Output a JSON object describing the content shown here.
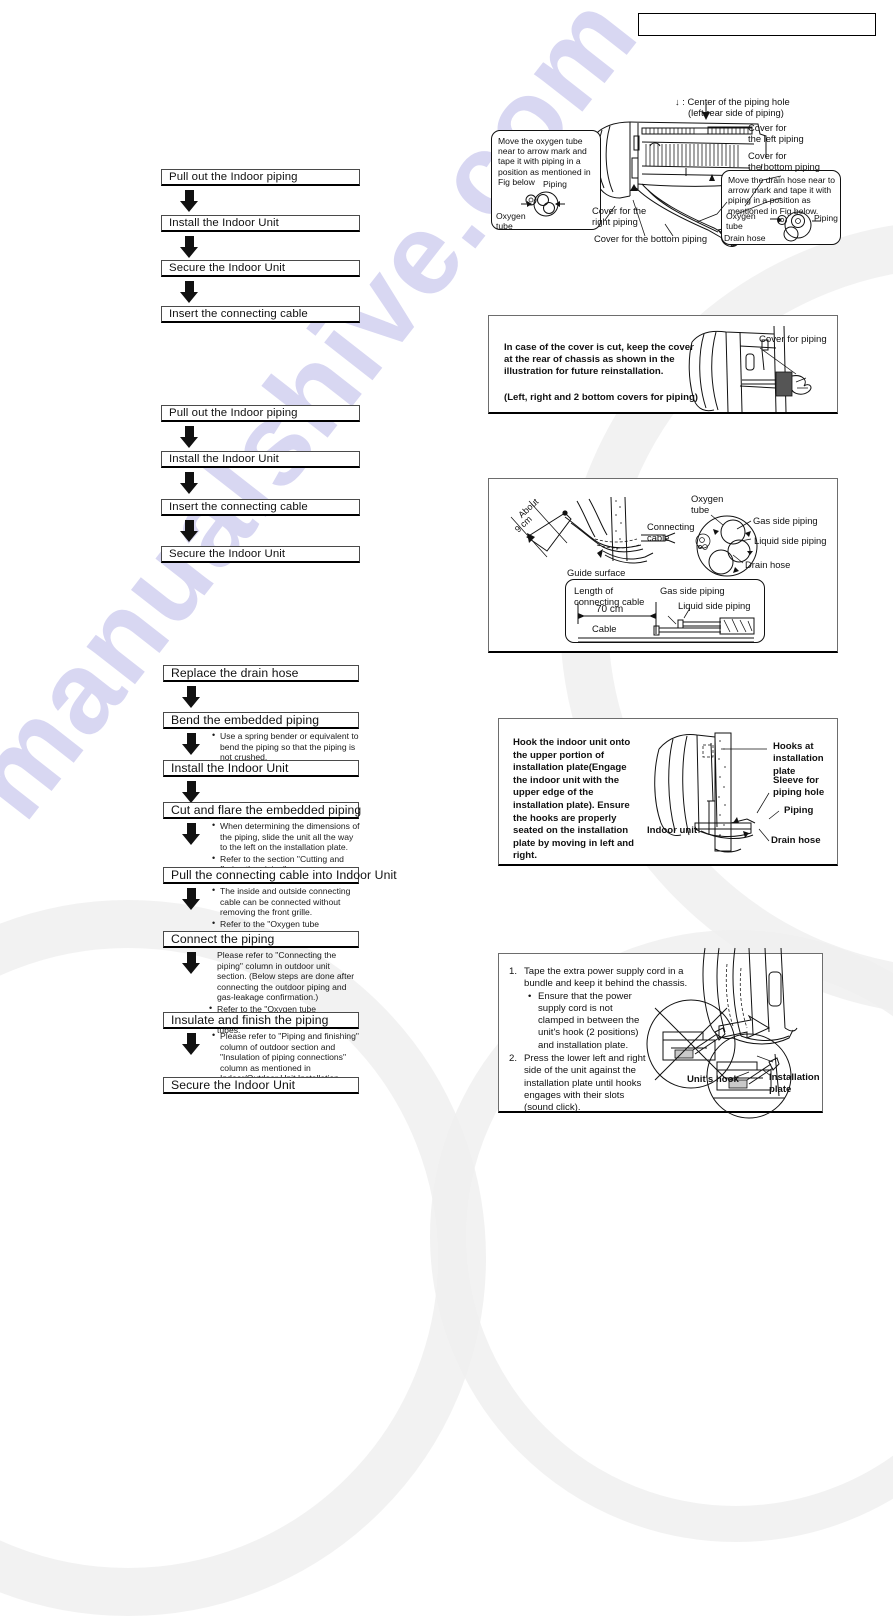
{
  "document": {
    "type": "installation-manual-page",
    "header_box_label": ""
  },
  "flowcharts": [
    {
      "id": "flow-a",
      "steps": [
        {
          "label": "Pull out the Indoor piping"
        },
        {
          "label": "Install the Indoor Unit"
        },
        {
          "label": "Secure the Indoor Unit"
        },
        {
          "label": "Insert the connecting cable"
        }
      ]
    },
    {
      "id": "flow-b",
      "steps": [
        {
          "label": "Pull out the Indoor piping"
        },
        {
          "label": "Install the Indoor Unit"
        },
        {
          "label": "Insert the connecting cable"
        },
        {
          "label": "Secure the Indoor Unit"
        }
      ]
    },
    {
      "id": "flow-c",
      "steps": [
        {
          "label": "Replace the drain hose",
          "notes": []
        },
        {
          "label": "Bend the embedded piping",
          "notes": [
            "Use a spring bender or equivalent to bend the piping so that the piping is not crushed."
          ]
        },
        {
          "label": "Install the Indoor Unit",
          "notes": []
        },
        {
          "label": "Cut and flare the embedded piping",
          "notes": [
            "When determining the dimensions of the piping, slide the unit all the way to the left on the installation plate.",
            "Refer to the section \"Cutting and flaring the piping\"."
          ]
        },
        {
          "label": "Pull the connecting cable into Indoor Unit",
          "notes": [
            "The inside and outside connecting cable can be connected without removing the front grille.",
            "Refer to the \"Oxygen tube connection\" for cutting oxygen tube."
          ]
        },
        {
          "label": "Connect the piping",
          "notes": [
            "Please refer to \"Connecting the piping\" column in outdoor unit section. (Below steps are done after connecting the outdoor piping and gas-leakage confirmation.)",
            "Refer to the \"Oxygen tube connection\" for connecting oxygen tubes."
          ]
        },
        {
          "label": "Insulate and finish the piping",
          "notes": [
            "Please refer to \"Piping and finishing\" column of outdoor section and \"Insulation of piping connections\" column as mentioned in Indoor/Outdoor Unit Installation."
          ]
        },
        {
          "label": "Secure the Indoor Unit",
          "notes": []
        }
      ]
    }
  ],
  "panels": {
    "piping_hole": {
      "center_note_line1": "↓ : Center of the piping hole",
      "center_note_line2": "(left rear side of piping)",
      "left_callout": "Move the oxygen tube near to arrow mark and tape it with piping in a position as mentioned in Fig below",
      "left_callout_piping": "Piping",
      "left_callout_oxygen": "Oxygen\ntube",
      "right_callout": "Move the drain hose near to arrow mark and tape it with piping in a position as mentioned in Fig below.",
      "right_callout_oxygen": "Oxygen\ntube",
      "right_callout_piping": "Piping",
      "right_callout_drain": "Drain hose",
      "label_cover_left": "Cover for\nthe left piping",
      "label_cover_bottom_r": "Cover for\nthe bottom piping",
      "label_cover_right": "Cover for the\nright piping",
      "label_cover_bottom": "Cover for the bottom piping"
    },
    "cover_cut": {
      "text_line1": "In case of the cover is cut, keep the cover",
      "text_line2": "at the rear of chassis as shown in the",
      "text_line3": "illustration for future reinstallation.",
      "text_line4": "(Left, right and 2 bottom covers for piping)",
      "label_cover": "Cover for piping"
    },
    "cable_routing": {
      "label_about": "About",
      "label_about_value": "9 cm",
      "label_guide": "Guide surface",
      "label_connecting_cable_lower": "Connecting cable",
      "label_connecting_cable_upper": "Connecting\ncable",
      "label_oxygen_tube": "Oxygen\ntube",
      "label_gas_side": "Gas side piping",
      "label_liquid_side": "Liquid side piping",
      "label_drain_hose": "Drain hose",
      "inset_title": "Length of\nconnecting cable",
      "inset_value": "70 cm",
      "inset_cable": "Cable",
      "inset_gas": "Gas side piping",
      "inset_liquid": "Liquid side piping"
    },
    "hook_unit": {
      "text": "Hook the indoor unit onto the upper portion of installation plate(Engage the indoor unit with the upper edge of the installation plate). Ensure the hooks are properly seated on the installation plate by moving in left and right.",
      "label_hooks": "Hooks at\ninstallation plate",
      "label_sleeve": "Sleeve for\npiping hole",
      "label_piping": "Piping",
      "label_drain_hose": "Drain hose",
      "label_indoor_unit": "Indoor unit"
    },
    "power_cord": {
      "item1_num": "1.",
      "item1_text": "Tape the extra power supply cord in a bundle and keep it behind the chassis.",
      "item1_sub": "Ensure that the power supply cord is not clamped in between the unit's hook (2 positions) and installation plate.",
      "item2_num": "2.",
      "item2_text": "Press the lower left and right side of the unit against the installation plate until hooks engages with their slots (sound click).",
      "label_unit_hook": "Unit's hook",
      "label_installation_plate": "Installation\nplate"
    }
  },
  "watermark": {
    "text": "manualshive.com"
  }
}
